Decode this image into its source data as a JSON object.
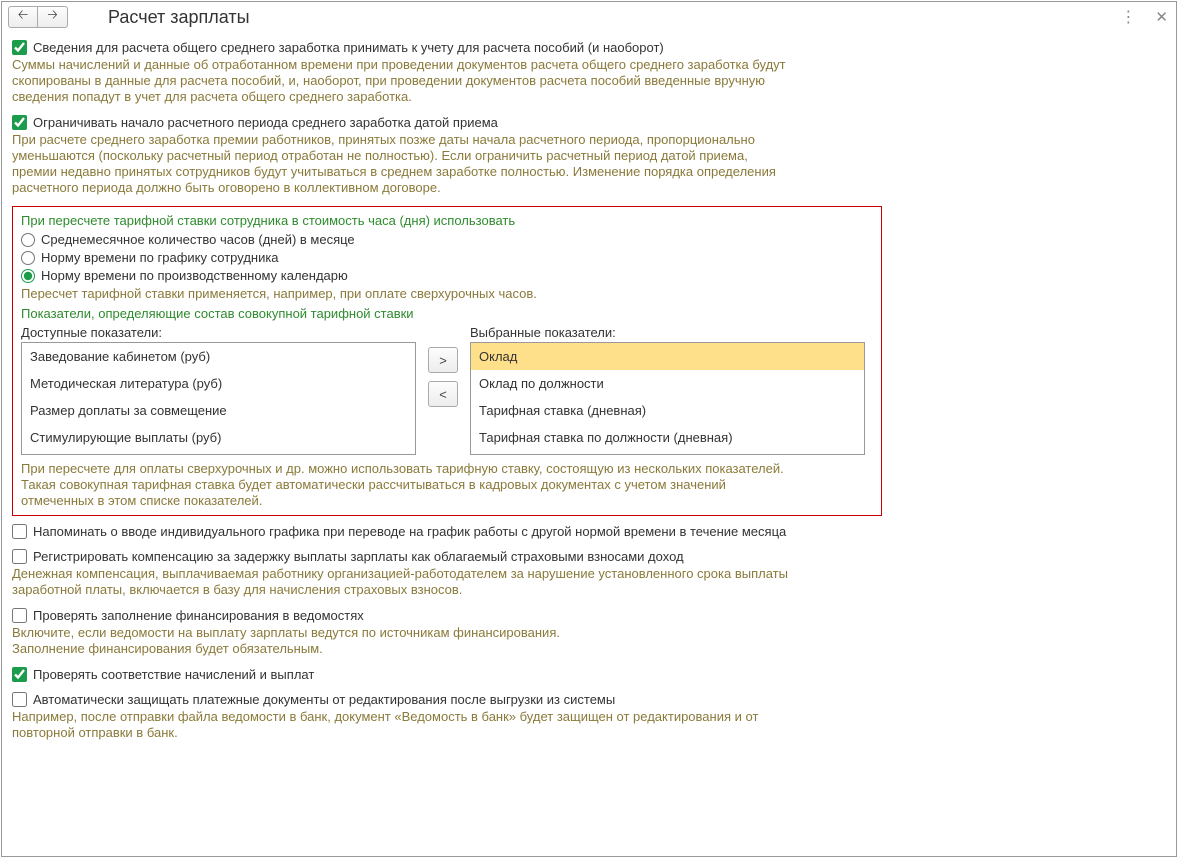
{
  "header": {
    "title": "Расчет зарплаты"
  },
  "check1": {
    "label": "Сведения для расчета общего среднего заработка принимать к учету для расчета пособий (и наоборот)",
    "checked": true,
    "desc": "Суммы начислений и данные об отработанном времени при проведении документов расчета общего среднего заработка будут скопированы в данные для расчета пособий, и, наоборот, при проведении документов расчета пособий введенные вручную сведения попадут в учет для расчета общего среднего заработка."
  },
  "check2": {
    "label": "Ограничивать начало расчетного периода среднего заработка датой приема",
    "checked": true,
    "desc": "При расчете среднего заработка премии работников, принятых позже даты начала расчетного периода, пропорционально уменьшаются (поскольку расчетный период отработан не полностью). Если ограничить расчетный период датой приема, премии недавно принятых сотрудников будут учитываться в среднем заработке полностью. Изменение порядка определения расчетного периода должно быть оговорено в коллективном договоре."
  },
  "box": {
    "heading1": "При пересчете тарифной ставки сотрудника в стоимость часа (дня) использовать",
    "radio1": "Среднемесячное количество часов (дней) в месяце",
    "radio2": "Норму времени по графику сотрудника",
    "radio3": "Норму времени по производственному календарю",
    "desc1": "Пересчет тарифной ставки применяется, например, при оплате сверхурочных часов.",
    "heading2": "Показатели, определяющие состав совокупной тарифной ставки",
    "available_label": "Доступные показатели:",
    "selected_label": "Выбранные показатели:",
    "available": [
      "Заведование кабинетом (руб)",
      "Методическая литература (руб)",
      "Размер доплаты за совмещение",
      "Стимулирующие выплаты (руб)"
    ],
    "selected": [
      "Оклад",
      "Оклад по должности",
      "Тарифная ставка (дневная)",
      "Тарифная ставка по должности (дневная)"
    ],
    "move_right": ">",
    "move_left": "<",
    "desc2": "При пересчете для оплаты сверхурочных и др. можно использовать тарифную ставку, состоящую из нескольких показателей. Такая совокупная тарифная ставка будет автоматически рассчитываться в кадровых документах с учетом значений отмеченных в этом списке показателей."
  },
  "check3": {
    "label": "Напоминать о вводе индивидуального графика при переводе на график работы с другой нормой времени в течение месяца",
    "checked": false
  },
  "check4": {
    "label": "Регистрировать компенсацию за задержку выплаты зарплаты как облагаемый страховыми взносами доход",
    "checked": false,
    "desc": "Денежная компенсация, выплачиваемая работнику организацией-работодателем за нарушение установленного срока выплаты заработной платы, включается в базу для начисления страховых взносов."
  },
  "check5": {
    "label": "Проверять заполнение финансирования в ведомостях",
    "checked": false,
    "desc": "Включите, если ведомости на выплату зарплаты ведутся по источникам финансирования.\nЗаполнение финансирования будет обязательным."
  },
  "check6": {
    "label": "Проверять соответствие начислений и выплат",
    "checked": true
  },
  "check7": {
    "label": "Автоматически защищать платежные документы от редактирования после выгрузки из системы",
    "checked": false,
    "desc": "Например, после отправки файла ведомости в банк, документ «Ведомость в банк» будет защищен от редактирования и от повторной отправки в банк."
  }
}
